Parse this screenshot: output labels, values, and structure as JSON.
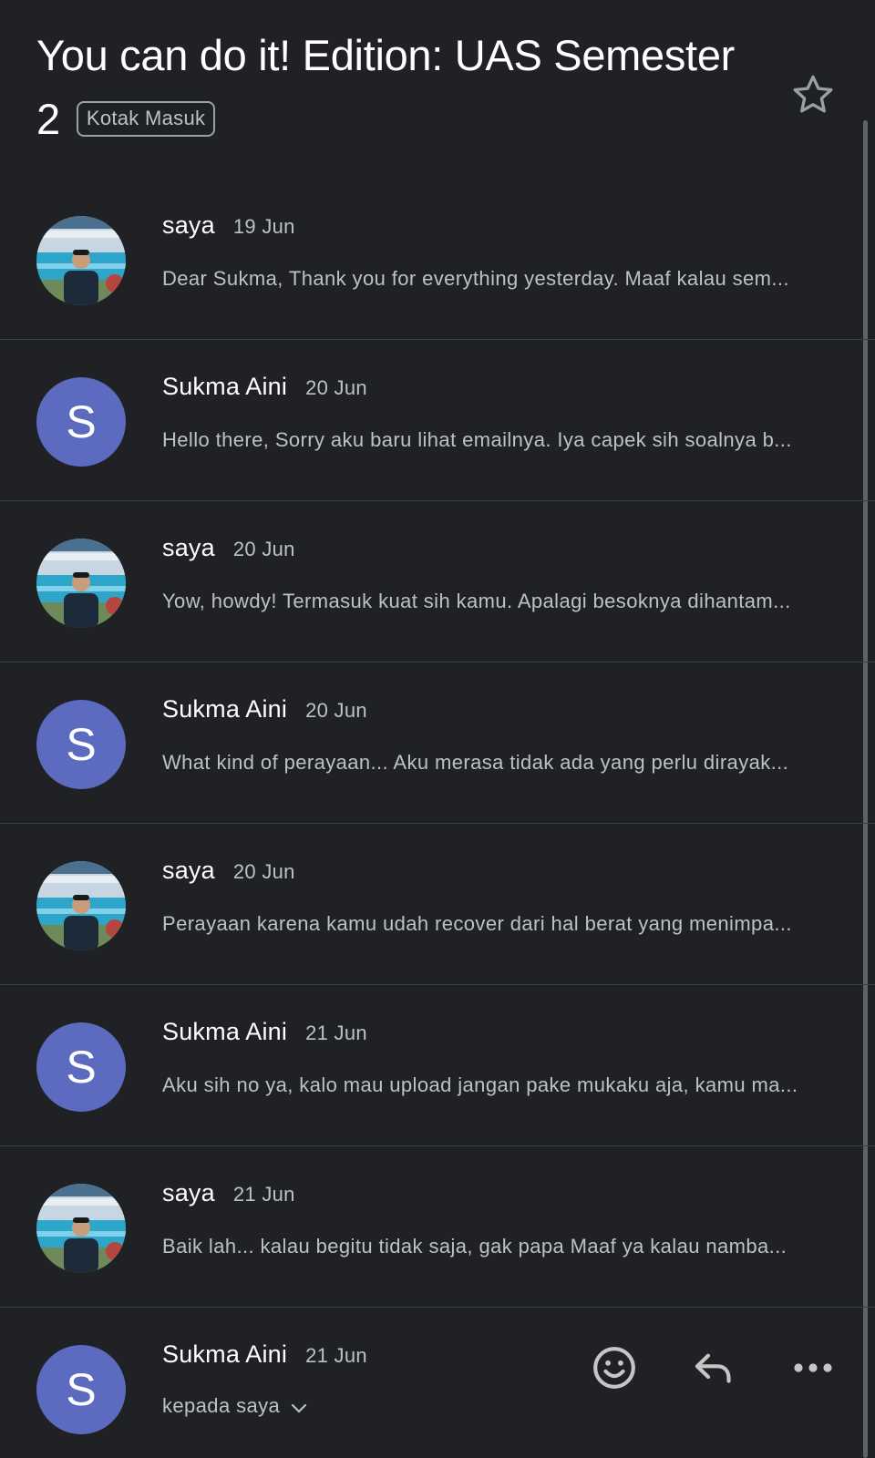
{
  "header": {
    "subject": "You can do it! Edition: UAS Semester 2",
    "label": "Kotak Masuk",
    "star_icon": "star-outline-icon"
  },
  "messages": [
    {
      "sender": "saya",
      "date": "19 Jun",
      "avatar_type": "photo",
      "snippet": "Dear Sukma, Thank you for everything yesterday. Maaf kalau sem..."
    },
    {
      "sender": "Sukma Aini",
      "date": "20 Jun",
      "avatar_type": "letter",
      "avatar_letter": "S",
      "snippet": "Hello there, Sorry aku baru lihat emailnya. Iya capek sih soalnya b..."
    },
    {
      "sender": "saya",
      "date": "20 Jun",
      "avatar_type": "photo",
      "snippet": "Yow, howdy! Termasuk kuat sih kamu. Apalagi besoknya dihantam..."
    },
    {
      "sender": "Sukma Aini",
      "date": "20 Jun",
      "avatar_type": "letter",
      "avatar_letter": "S",
      "snippet": "What kind of perayaan... Aku merasa tidak ada yang perlu dirayak..."
    },
    {
      "sender": "saya",
      "date": "20 Jun",
      "avatar_type": "photo",
      "snippet": "Perayaan karena kamu udah recover dari hal berat yang menimpa..."
    },
    {
      "sender": "Sukma Aini",
      "date": "21 Jun",
      "avatar_type": "letter",
      "avatar_letter": "S",
      "snippet": "Aku sih no ya, kalo mau upload jangan pake mukaku aja, kamu ma..."
    },
    {
      "sender": "saya",
      "date": "21 Jun",
      "avatar_type": "photo",
      "snippet": "Baik lah... kalau begitu tidak saja, gak papa Maaf ya kalau namba..."
    }
  ],
  "open_message": {
    "sender": "Sukma Aini",
    "date": "21 Jun",
    "avatar_letter": "S",
    "recipient": "kepada saya",
    "actions": [
      "emoji-reaction-icon",
      "reply-icon",
      "more-options-icon"
    ]
  },
  "colors": {
    "background": "#202124",
    "divider": "#3c4043",
    "avatar_letter_bg": "#5c6bc0",
    "primary_text": "#ffffff",
    "secondary_text": "#bdc1c6"
  }
}
